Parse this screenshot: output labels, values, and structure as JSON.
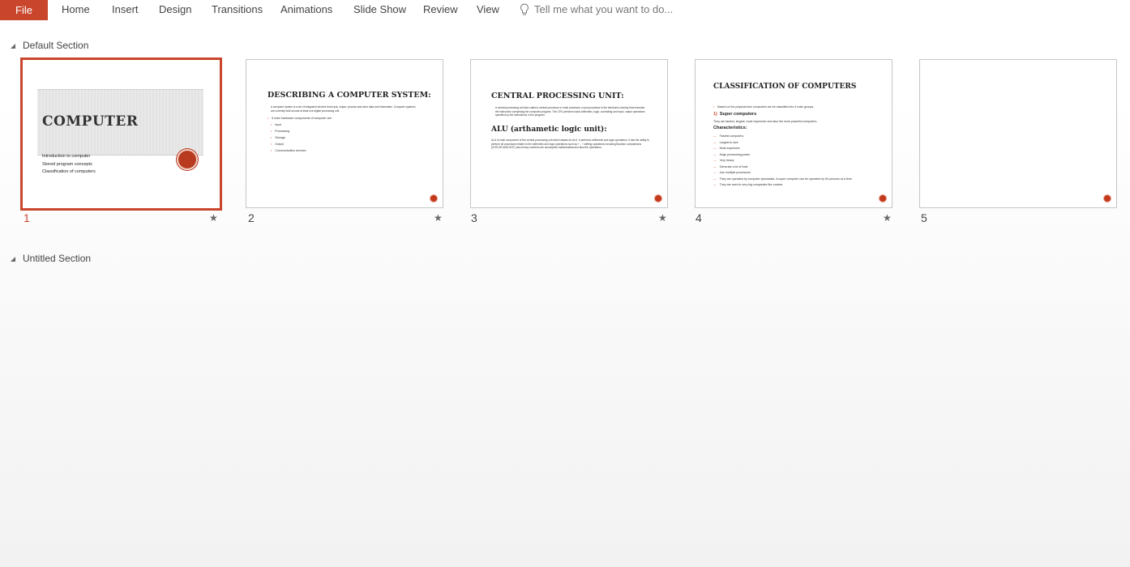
{
  "ribbon": {
    "file": "File",
    "tabs": [
      "Home",
      "Insert",
      "Design",
      "Transitions",
      "Animations",
      "Slide Show",
      "Review",
      "View"
    ],
    "tell_me": "Tell me what you want to do..."
  },
  "sections": {
    "default": "Default Section",
    "untitled": "Untitled Section"
  },
  "colors": {
    "accent": "#c9462c"
  },
  "slides": [
    {
      "number": "1",
      "title": "COMPUTER",
      "lines": [
        "Introduction to computer",
        "Stored program concepts",
        "Classification of computers"
      ],
      "has_animation": true
    },
    {
      "number": "2",
      "title": "DESCRIBING A COMPUTER SYSTEM:",
      "paragraph": "A computer system is a set of integrated devices that input, output, process and store data and information. Computer systems are currently built around at least one digital processing unit.",
      "intro": "5 main hardware components of computer are:",
      "items": [
        "Input",
        "Processing",
        "Storage",
        "Output",
        "Communication devices"
      ],
      "has_animation": true
    },
    {
      "number": "3",
      "title": "CENTRAL PROCESSING UNIT:",
      "paragraph": "A central processing unit also called a central processor or main processor or just processor is the electronic circuitry that executes the instruction comprising the computer program. The CPU performs basic arithmetic, logic, controlling and input, output operations specified by the instructions in the program.",
      "subtitle": "ALU (arthametic logic unit):",
      "paragraph2": "ALU is main component of the central processing unit which stands for ALU. It performs arithmetic and logic operations. It has the ability to perform all processes related to the arithmetic and logic operations such as + - ÷ shifting operations including Boolean comparisons (XOR,OR,AND,NOT) also binary numbers are accomplish mathematical and also the operations.",
      "has_animation": true
    },
    {
      "number": "4",
      "title": "CLASSIFICATION OF COMPUTERS",
      "intro": "Based on the physical size computers are be classified into 4 main groups:",
      "subtitle": "Super computers",
      "line": "They are fastest, largest, most expensive and also the most powerful computers.",
      "char_head": "Characteristics:",
      "items": [
        "Fastest computers",
        "Largest in size",
        "Most expensive",
        "Huge processing power",
        "Very heavy",
        "Generate a lot of heat",
        "Use multiple processors",
        "They are operated by computer specialists. A super computer can be operated by 50 persons at a time.",
        "They are used in very big companies like nuclear"
      ],
      "has_animation": true
    },
    {
      "number": "5",
      "has_animation": false
    }
  ]
}
